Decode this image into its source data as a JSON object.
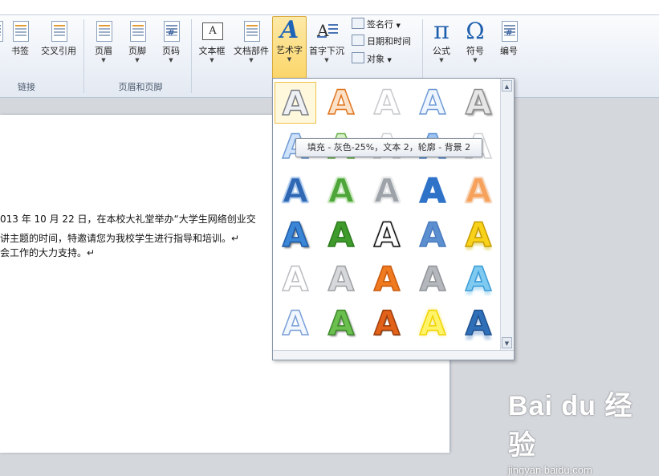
{
  "ribbon": {
    "buttons": [
      {
        "name": "partial-left",
        "label": "表"
      },
      {
        "name": "bookmark",
        "label": "书签"
      },
      {
        "name": "cross-ref",
        "label": "交叉引用"
      },
      {
        "name": "header",
        "label": "页眉"
      },
      {
        "name": "footer",
        "label": "页脚"
      },
      {
        "name": "page-number",
        "label": "页码"
      },
      {
        "name": "textbox",
        "label": "文本框"
      },
      {
        "name": "quick-parts",
        "label": "文档部件"
      },
      {
        "name": "wordart",
        "label": "艺术字"
      },
      {
        "name": "dropcap",
        "label": "首字下沉"
      },
      {
        "name": "equation",
        "label": "公式"
      },
      {
        "name": "symbol",
        "label": "符号"
      },
      {
        "name": "numbering",
        "label": "编号"
      }
    ],
    "small_items": [
      {
        "label": "签名行"
      },
      {
        "label": "日期和时间"
      },
      {
        "label": "对象"
      }
    ],
    "groups": {
      "links": "链接",
      "header_footer": "页眉和页脚"
    },
    "glyphs": {
      "pi": "π",
      "omega": "Ω",
      "wordart": "A"
    }
  },
  "document": {
    "lines": [
      "013 年 10 月 22 日，在本校大礼堂举办“大学生网络创业交",
      "讲主题的时间，特邀请您为我校学生进行指导和培训。↵",
      "会工作的大力支持。↵"
    ]
  },
  "gallery": {
    "glyph": "A",
    "tooltip": "填充 - 灰色-25%，文本 2，轮廓 - 背景 2",
    "cells": [
      {
        "row": 0,
        "col": 0,
        "style": "gray-outline",
        "selected": true
      },
      {
        "row": 0,
        "col": 1,
        "style": "orange-outline"
      },
      {
        "row": 0,
        "col": 2,
        "style": "white-outline"
      },
      {
        "row": 0,
        "col": 3,
        "style": "blue-outline"
      },
      {
        "row": 0,
        "col": 4,
        "style": "gray-shadow"
      },
      {
        "row": 1,
        "col": 0,
        "style": "blue-light"
      },
      {
        "row": 1,
        "col": 1,
        "style": "green-light"
      },
      {
        "row": 1,
        "col": 2,
        "style": "white-light"
      },
      {
        "row": 1,
        "col": 3,
        "style": "blue-mid"
      },
      {
        "row": 1,
        "col": 4,
        "style": "white-light"
      },
      {
        "row": 2,
        "col": 0,
        "style": "blue-bevel"
      },
      {
        "row": 2,
        "col": 1,
        "style": "green-bevel"
      },
      {
        "row": 2,
        "col": 2,
        "style": "silver-bevel"
      },
      {
        "row": 2,
        "col": 3,
        "style": "blue-gradient"
      },
      {
        "row": 2,
        "col": 4,
        "style": "orange-bevel"
      },
      {
        "row": 3,
        "col": 0,
        "style": "blue-solid"
      },
      {
        "row": 3,
        "col": 1,
        "style": "green-solid"
      },
      {
        "row": 3,
        "col": 2,
        "style": "black-outline"
      },
      {
        "row": 3,
        "col": 3,
        "style": "blue-soft"
      },
      {
        "row": 3,
        "col": 4,
        "style": "gold"
      },
      {
        "row": 4,
        "col": 0,
        "style": "white-thin"
      },
      {
        "row": 4,
        "col": 1,
        "style": "silver-thin"
      },
      {
        "row": 4,
        "col": 2,
        "style": "orange-solid"
      },
      {
        "row": 4,
        "col": 3,
        "style": "silver-solid"
      },
      {
        "row": 4,
        "col": 4,
        "style": "cyan-reflect"
      },
      {
        "row": 5,
        "col": 0,
        "style": "blue-outline-light"
      },
      {
        "row": 5,
        "col": 1,
        "style": "green-shadow"
      },
      {
        "row": 5,
        "col": 2,
        "style": "orange-dark"
      },
      {
        "row": 5,
        "col": 3,
        "style": "yellow-glow"
      },
      {
        "row": 5,
        "col": 4,
        "style": "blue-reflect"
      }
    ]
  },
  "watermark": {
    "brand": "Bai du 经验",
    "url": "jingyan.baidu.com"
  },
  "colors": {
    "accent": "#f0c04a",
    "ribbon_bg": "#eef2f8",
    "doc_bg": "#ffffff"
  }
}
